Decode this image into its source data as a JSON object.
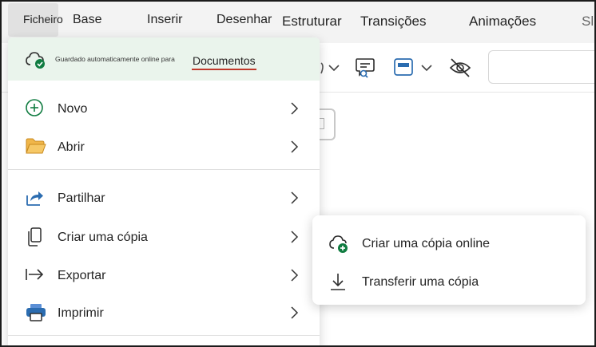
{
  "ribbon": {
    "tabs": {
      "file": "Ficheiro",
      "home": "Base",
      "insert": "Inserir",
      "draw": "Desenhar",
      "design": "Estruturar",
      "transitions": "Transições",
      "animations": "Animações",
      "slideshow": "Sl"
    }
  },
  "file_menu": {
    "autosave_label": "Guardado automaticamente online para",
    "autosave_location": "Documentos",
    "items": {
      "new": "Novo",
      "open": "Abrir",
      "share": "Partilhar",
      "create_copy": "Criar uma cópia",
      "export": "Exportar",
      "print": "Imprimir"
    }
  },
  "copy_submenu": {
    "online_copy": "Criar uma cópia online",
    "download_copy": "Transferir uma cópia"
  },
  "colors": {
    "accent_green": "#107c41",
    "autosave_bg": "#eaf4ec",
    "underline_red": "#c0392b",
    "folder_orange": "#e8a33a",
    "share_blue": "#2b6cb0"
  }
}
